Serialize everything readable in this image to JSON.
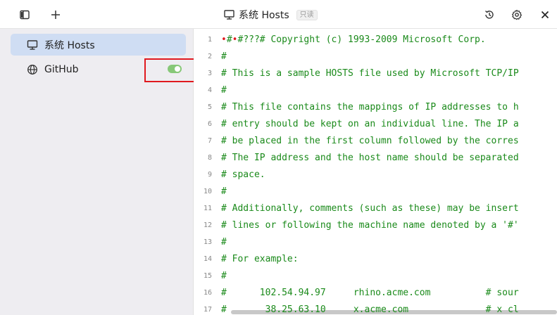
{
  "titlebar": {
    "title": "系统 Hosts",
    "badge": "只读"
  },
  "sidebar": {
    "items": [
      {
        "label": "系统 Hosts",
        "icon": "monitor-icon"
      },
      {
        "label": "GitHub",
        "icon": "globe-icon",
        "toggle_on": true
      }
    ]
  },
  "editor": {
    "lines": [
      {
        "n": "1",
        "text": "#??# Copyright (c) 1993-2009 Microsoft Corp."
      },
      {
        "n": "2",
        "text": "#"
      },
      {
        "n": "3",
        "text": "# This is a sample HOSTS file used by Microsoft TCP/IP"
      },
      {
        "n": "4",
        "text": "#"
      },
      {
        "n": "5",
        "text": "# This file contains the mappings of IP addresses to h"
      },
      {
        "n": "6",
        "text": "# entry should be kept on an individual line. The IP a"
      },
      {
        "n": "7",
        "text": "# be placed in the first column followed by the corres"
      },
      {
        "n": "8",
        "text": "# The IP address and the host name should be separated"
      },
      {
        "n": "9",
        "text": "# space."
      },
      {
        "n": "10",
        "text": "#"
      },
      {
        "n": "11",
        "text": "# Additionally, comments (such as these) may be insert"
      },
      {
        "n": "12",
        "text": "# lines or following the machine name denoted by a '#'"
      },
      {
        "n": "13",
        "text": "#"
      },
      {
        "n": "14",
        "text": "# For example:"
      },
      {
        "n": "15",
        "text": "#"
      },
      {
        "n": "16",
        "text": "#      102.54.94.97     rhino.acme.com          # sour"
      },
      {
        "n": "17",
        "text": "#       38.25.63.10     x.acme.com              # x cl"
      }
    ],
    "line1_prefix": "•#•#???"
  },
  "colors": {
    "comment": "#1a8a1a",
    "active_item": "#cfddf3",
    "toggle_on": "#87c878",
    "highlight": "#e0191f"
  }
}
